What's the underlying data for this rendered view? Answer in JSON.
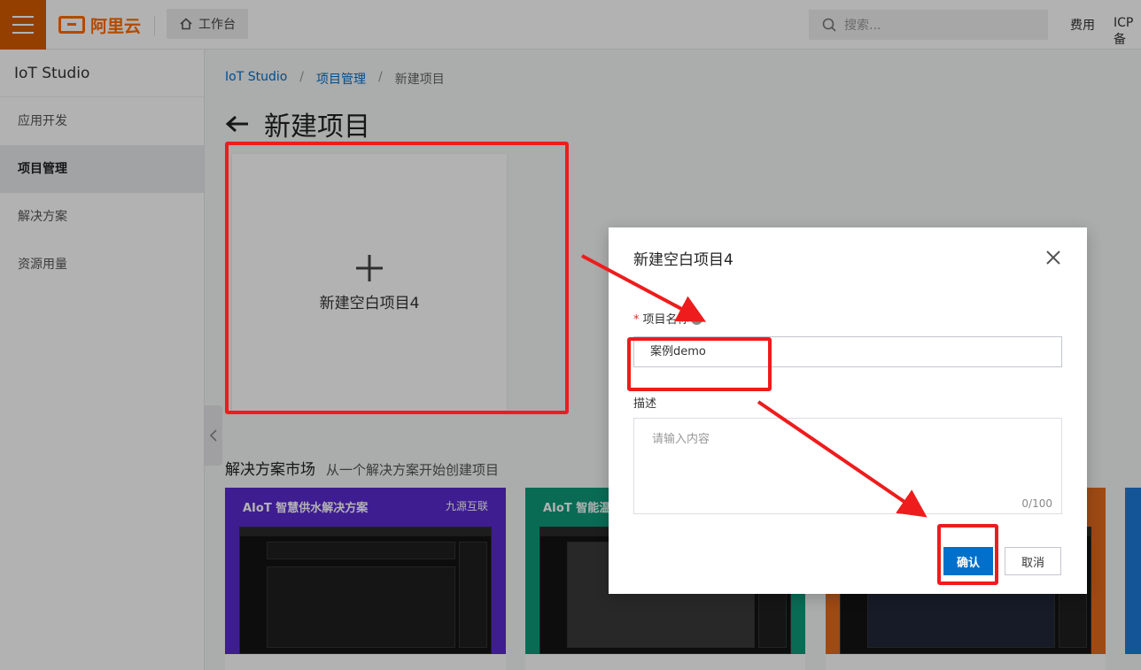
{
  "topbar": {
    "logo_text": "阿里云",
    "workbench_label": "工作台",
    "search_placeholder": "搜索...",
    "links": [
      "费用",
      "ICP 备"
    ]
  },
  "sidebar": {
    "title": "IoT Studio",
    "items": [
      {
        "label": "应用开发",
        "active": false
      },
      {
        "label": "项目管理",
        "active": true
      },
      {
        "label": "解决方案",
        "active": false
      },
      {
        "label": "资源用量",
        "active": false
      }
    ]
  },
  "breadcrumb": {
    "items": [
      "IoT Studio",
      "项目管理"
    ],
    "separator": "/",
    "current": "新建项目"
  },
  "page": {
    "title": "新建项目",
    "blank_card_label": "新建空白项目4"
  },
  "solutions": {
    "title": "解决方案市场",
    "subtitle": "从一个解决方案开始创建项目",
    "cards": [
      {
        "title": "AIoT 智慧供水解决方案",
        "brand": "九源互联",
        "color": "#5a2ad0"
      },
      {
        "title": "AIoT 智能温室",
        "brand": "",
        "color": "#0f9a7a"
      },
      {
        "title": "",
        "brand": "",
        "color": "#e26a1e"
      }
    ]
  },
  "dialog": {
    "title": "新建空白项目4",
    "name_label": "项目名称",
    "required_mark": "*",
    "name_value": "案例demo",
    "desc_label": "描述",
    "desc_placeholder": "请输入内容",
    "desc_counter": "0/100",
    "ok_label": "确认",
    "cancel_label": "取消"
  },
  "colors": {
    "brand_orange": "#ff6a00",
    "primary_blue": "#0070cc",
    "annotation_red": "#ee1c1c"
  }
}
